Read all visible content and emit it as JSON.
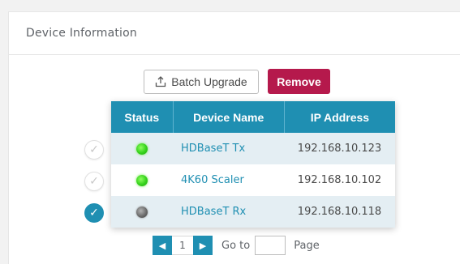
{
  "panel": {
    "title": "Device Information"
  },
  "toolbar": {
    "batch_upgrade_label": "Batch Upgrade",
    "remove_label": "Remove"
  },
  "table": {
    "headers": {
      "status": "Status",
      "device_name": "Device Name",
      "ip_address": "IP Address"
    },
    "rows": [
      {
        "selected": false,
        "status": "online",
        "status_color": "#3ad11e",
        "device_name": "HDBaseT Tx",
        "ip": "192.168.10.123"
      },
      {
        "selected": false,
        "status": "online",
        "status_color": "#3ad11e",
        "device_name": "4K60 Scaler",
        "ip": "192.168.10.102"
      },
      {
        "selected": true,
        "status": "offline",
        "status_color": "#777777",
        "device_name": "HDBaseT Rx",
        "ip": "192.168.10.118"
      }
    ]
  },
  "pagination": {
    "prev_icon": "triangle-left-icon",
    "current_page": "1",
    "next_icon": "triangle-right-icon",
    "goto_label": "Go to",
    "goto_value": "",
    "page_label": "Page"
  },
  "colors": {
    "accent": "#1f8fb2",
    "remove": "#b5194c",
    "row_alt": "#e4eef3"
  }
}
